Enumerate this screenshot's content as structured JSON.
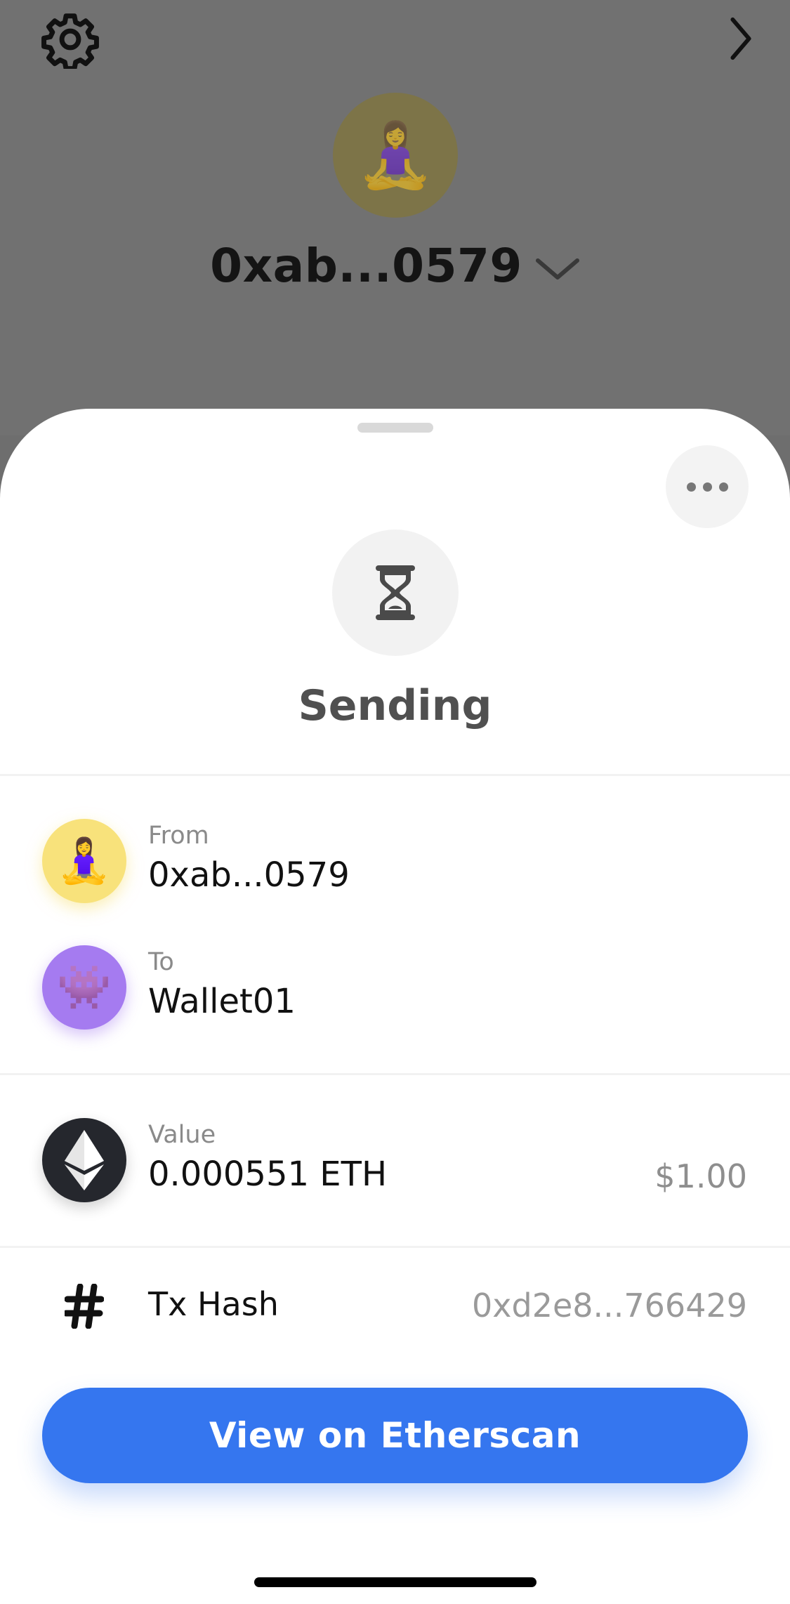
{
  "header": {
    "settings_icon": "gear-icon",
    "forward_icon": "chevron-right-icon",
    "wallet_avatar_emoji": "🧘‍♀️",
    "wallet_name": "0xab...0579"
  },
  "sheet": {
    "status_title": "Sending",
    "status_icon": "hourglass-icon",
    "from": {
      "label": "From",
      "value": "0xab...0579",
      "emoji": "🧘‍♀️",
      "color": "#f8e27b"
    },
    "to": {
      "label": "To",
      "value": "Wallet01",
      "emoji": "👾",
      "color": "#a57bf0"
    },
    "value": {
      "label": "Value",
      "amount": "0.000551 ETH",
      "usd": "$1.00"
    },
    "hash": {
      "label": "Tx Hash",
      "value": "0xd2e8...766429"
    },
    "button_label": "View on Etherscan"
  },
  "colors": {
    "accent": "#3576ef",
    "eth_bg": "#25272d"
  }
}
